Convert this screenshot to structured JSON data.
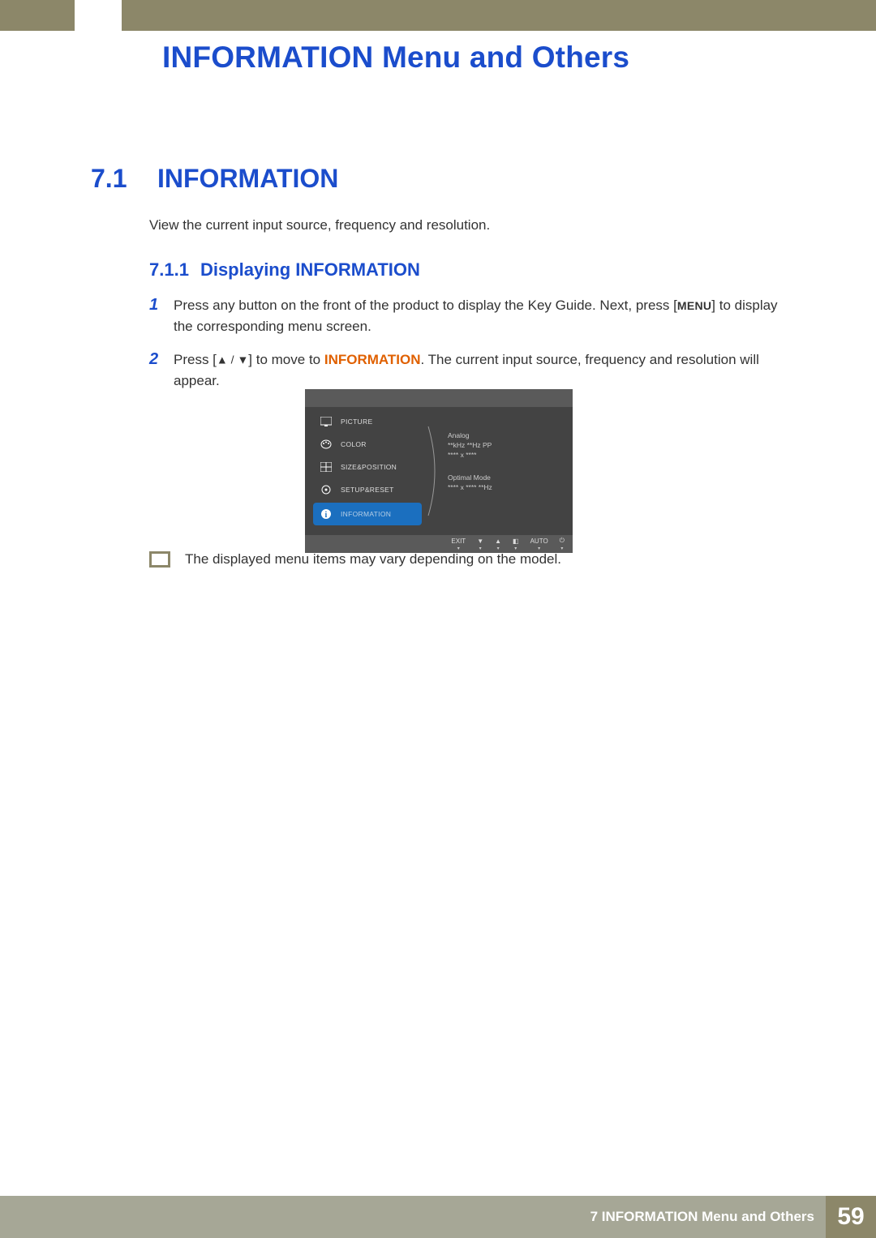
{
  "header": {
    "chapter_title": "INFORMATION Menu and Others"
  },
  "section": {
    "number": "7.1",
    "title": "INFORMATION",
    "intro": "View the current input source, frequency and resolution."
  },
  "subsection": {
    "number": "7.1.1",
    "title": "Displaying INFORMATION"
  },
  "steps": [
    {
      "num": "1",
      "before_menu": "Press any button on the front of the product to display the Key Guide. Next, press [",
      "menu_label": "MENU",
      "after_menu": "] to display the corresponding menu screen."
    },
    {
      "num": "2",
      "before_arrows": "Press [",
      "after_arrows": "] to move to ",
      "highlight": "INFORMATION",
      "after_highlight": ". The current input source, frequency and resolution will appear."
    }
  ],
  "osd": {
    "menu_items": [
      {
        "label": "PICTURE"
      },
      {
        "label": "COLOR"
      },
      {
        "label": "SIZE&POSITION"
      },
      {
        "label": "SETUP&RESET"
      },
      {
        "label": "INFORMATION",
        "selected": true
      }
    ],
    "info_block1": {
      "line1": "Analog",
      "line2": "**kHz **Hz PP",
      "line3": "**** x ****"
    },
    "info_block2": {
      "line1": "Optimal Mode",
      "line2": "**** x ****  **Hz"
    },
    "bottom_buttons": [
      "EXIT",
      "▼",
      "▲",
      "◧",
      "AUTO",
      "⏻"
    ]
  },
  "note": "The displayed menu items may vary depending on the model.",
  "footer": {
    "text": "7 INFORMATION Menu and Others",
    "page": "59"
  }
}
